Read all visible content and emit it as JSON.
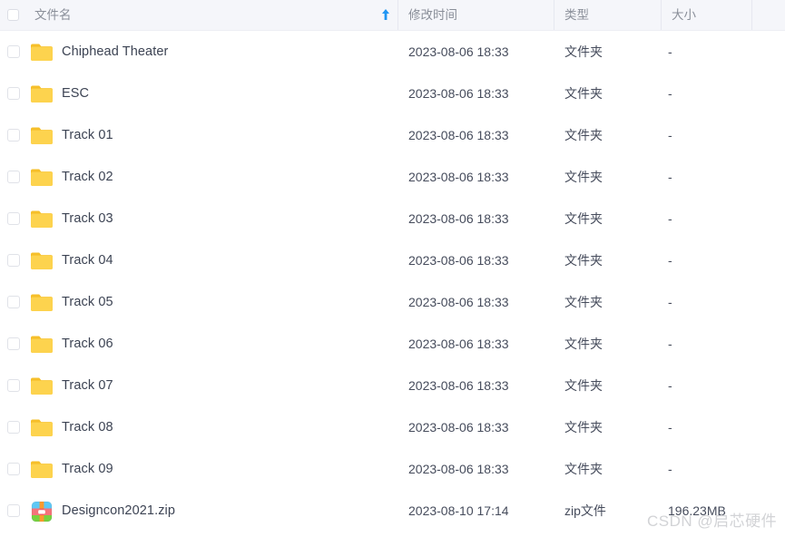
{
  "header": {
    "columns": [
      {
        "key": "name",
        "label": "文件名"
      },
      {
        "key": "date",
        "label": "修改时间"
      },
      {
        "key": "type",
        "label": "类型"
      },
      {
        "key": "size",
        "label": "大小"
      }
    ],
    "sort": {
      "column": "name",
      "direction": "asc",
      "icon": "arrow-up-icon",
      "color": "#2196f3"
    },
    "select_all_checked": false
  },
  "colors": {
    "header_background": "#f5f6fa",
    "row_background": "#ffffff",
    "divider": "#e6e8f0",
    "header_text": "#8a8f99",
    "row_text": "#3c4353",
    "folder_icon": "#fcc633",
    "accent": "#2196f3",
    "watermark_text": "#d2d3d6"
  },
  "rows": [
    {
      "name": "Chiphead Theater",
      "date": "2023-08-06 18:33",
      "type": "文件夹",
      "size": "-",
      "icon": "folder-icon",
      "checked": false
    },
    {
      "name": "ESC",
      "date": "2023-08-06 18:33",
      "type": "文件夹",
      "size": "-",
      "icon": "folder-icon",
      "checked": false
    },
    {
      "name": "Track 01",
      "date": "2023-08-06 18:33",
      "type": "文件夹",
      "size": "-",
      "icon": "folder-icon",
      "checked": false
    },
    {
      "name": "Track 02",
      "date": "2023-08-06 18:33",
      "type": "文件夹",
      "size": "-",
      "icon": "folder-icon",
      "checked": false
    },
    {
      "name": "Track 03",
      "date": "2023-08-06 18:33",
      "type": "文件夹",
      "size": "-",
      "icon": "folder-icon",
      "checked": false
    },
    {
      "name": "Track 04",
      "date": "2023-08-06 18:33",
      "type": "文件夹",
      "size": "-",
      "icon": "folder-icon",
      "checked": false
    },
    {
      "name": "Track 05",
      "date": "2023-08-06 18:33",
      "type": "文件夹",
      "size": "-",
      "icon": "folder-icon",
      "checked": false
    },
    {
      "name": "Track 06",
      "date": "2023-08-06 18:33",
      "type": "文件夹",
      "size": "-",
      "icon": "folder-icon",
      "checked": false
    },
    {
      "name": "Track 07",
      "date": "2023-08-06 18:33",
      "type": "文件夹",
      "size": "-",
      "icon": "folder-icon",
      "checked": false
    },
    {
      "name": "Track 08",
      "date": "2023-08-06 18:33",
      "type": "文件夹",
      "size": "-",
      "icon": "folder-icon",
      "checked": false
    },
    {
      "name": "Track 09",
      "date": "2023-08-06 18:33",
      "type": "文件夹",
      "size": "-",
      "icon": "folder-icon",
      "checked": false
    },
    {
      "name": "Designcon2021.zip",
      "date": "2023-08-10 17:14",
      "type": "zip文件",
      "size": "196.23MB",
      "icon": "zip-archive-icon",
      "checked": false
    }
  ],
  "watermark": {
    "text": "CSDN @启芯硬件"
  }
}
